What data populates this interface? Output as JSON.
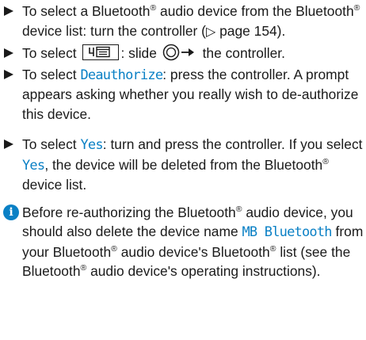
{
  "steps": [
    {
      "part1": "To select a Bluetooth",
      "sup1": "®",
      "part2": " audio device from the Bluetooth",
      "sup2": "®",
      "part3": " device list: turn the controller (",
      "page_ref_symbol": "▷",
      "part4": " page 154)."
    },
    {
      "before_icon": "To select ",
      "after_icon": ": slide ",
      "end": " the controller.",
      "icon_name": "menu-icon",
      "slide_icon_name": "controller-slide-right-icon"
    },
    {
      "part1": "To select ",
      "highlight": "Deauthorize",
      "part2": ": press the controller. A prompt appears asking whether you really wish to de-authorize this device."
    },
    {
      "part1": "To select ",
      "highlight1": "Yes",
      "part2": ": turn and press the controller. If you select ",
      "highlight2": "Yes",
      "part3": ", the device will be deleted from the Bluetooth",
      "sup": "®",
      "part4": " device list."
    }
  ],
  "note": {
    "icon": "i",
    "part1": "Before re-authorizing the Bluetooth",
    "sup1": "®",
    "part2": " audio device, you should also delete the device name ",
    "highlight": "MB Bluetooth",
    "part3": " from your Bluetooth",
    "sup2": "®",
    "part4": " audio device's Bluetooth",
    "sup3": "®",
    "part5": " list (see the Blue­tooth",
    "sup4": "®",
    "part6": " audio device's operating instructions)."
  },
  "colors": {
    "highlight": "#0a80c5",
    "text": "#1a1a1a"
  }
}
